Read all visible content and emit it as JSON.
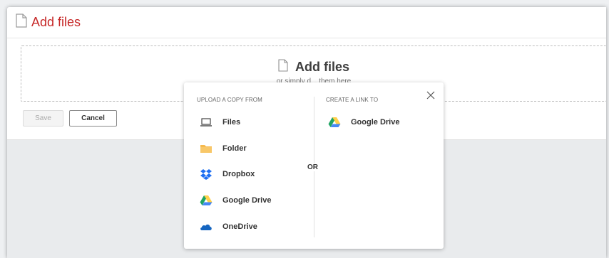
{
  "header": {
    "title": "Add files"
  },
  "dropzone": {
    "title": "Add files",
    "subtitle": "or simply d... them here"
  },
  "buttons": {
    "save": "Save",
    "cancel": "Cancel"
  },
  "modal": {
    "upload_title": "UPLOAD A COPY FROM",
    "link_title": "CREATE A LINK TO",
    "or_label": "OR",
    "upload_items": [
      {
        "label": "Files",
        "icon": "laptop-icon"
      },
      {
        "label": "Folder",
        "icon": "folder-icon"
      },
      {
        "label": "Dropbox",
        "icon": "dropbox-icon"
      },
      {
        "label": "Google Drive",
        "icon": "google-drive-icon"
      },
      {
        "label": "OneDrive",
        "icon": "onedrive-icon"
      }
    ],
    "link_items": [
      {
        "label": "Google Drive",
        "icon": "google-drive-icon"
      }
    ]
  },
  "colors": {
    "header_title": "#c62828",
    "folder": "#f6b94d",
    "dropbox": "#1f6ff2",
    "onedrive": "#1565c0",
    "gdrive_green": "#1fa463",
    "gdrive_yellow": "#ffd04b",
    "gdrive_blue": "#4688f4"
  }
}
